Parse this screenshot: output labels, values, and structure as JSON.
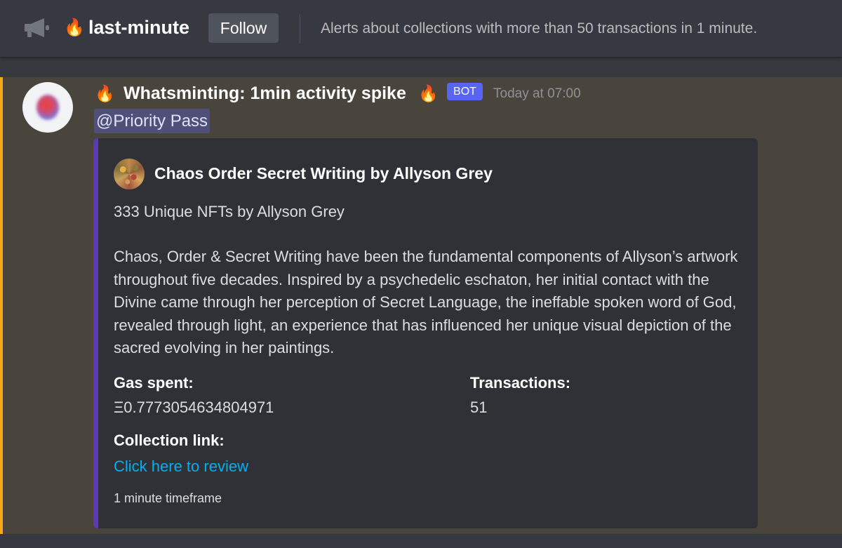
{
  "header": {
    "channel_icon": "megaphone-icon",
    "channel_emoji": "🔥",
    "channel_name": "last-minute",
    "follow_label": "Follow",
    "topic": "Alerts about collections with more than 50 transactions in 1 minute."
  },
  "message": {
    "author_prefix_emoji": "🔥",
    "author": "Whatsminting: 1min activity spike",
    "author_suffix_emoji": "🔥",
    "bot_badge": "BOT",
    "timestamp": "Today at 07:00",
    "mention": "@Priority Pass",
    "embed": {
      "accent_color": "#5b3ab5",
      "title": "Chaos Order Secret Writing by Allyson Grey",
      "subtitle": "333 Unique NFTs by Allyson Grey",
      "description": "Chaos, Order & Secret Writing have been the fundamental components of Allyson’s artwork throughout five decades. Inspired by a psychedelic eschaton, her initial contact with the Divine came through her perception of Secret Language, the ineffable spoken word of God, revealed through light, an experience that has influenced her unique visual depiction of the sacred evolving in her paintings.",
      "fields": {
        "gas_name": "Gas spent:",
        "gas_value": "Ξ0.7773054634804971",
        "tx_name": "Transactions:",
        "tx_value": "51",
        "link_name": "Collection link:",
        "link_text": "Click here to review"
      },
      "footer": "1 minute timeframe"
    }
  },
  "colors": {
    "background": "#36393f",
    "highlight_background": "#49443c",
    "highlight_accent": "#faa61a",
    "link": "#00aff4",
    "bot_badge": "#5865f2"
  }
}
